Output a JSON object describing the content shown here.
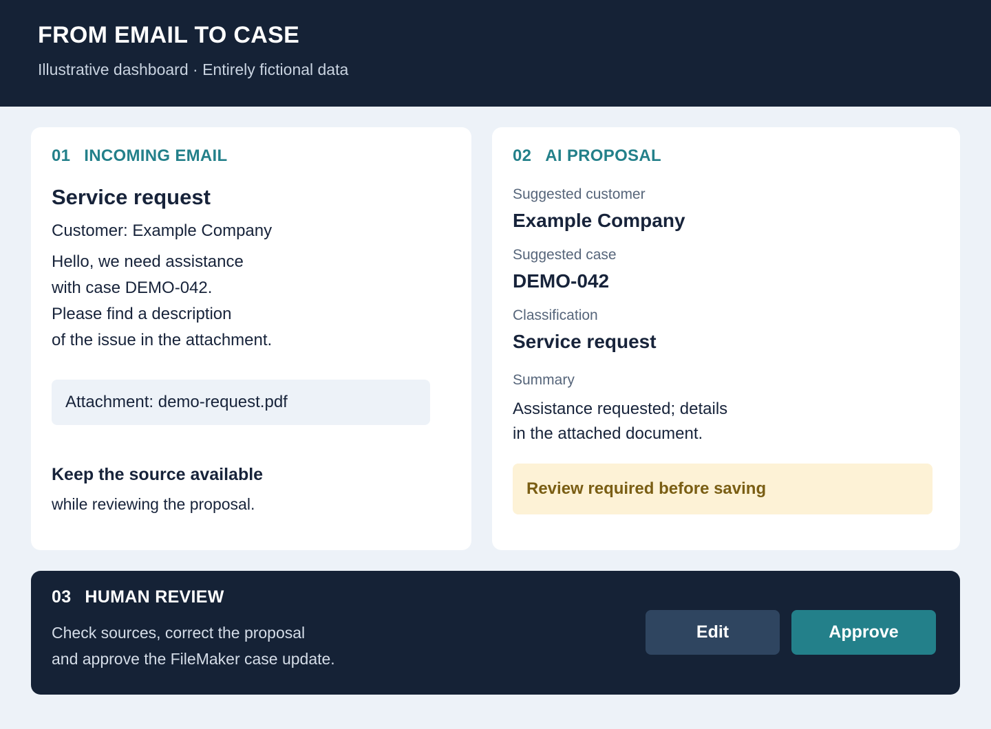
{
  "header": {
    "title": "FROM EMAIL TO CASE",
    "subtitle": "Illustrative dashboard · Entirely fictional data"
  },
  "incoming_email": {
    "number": "01",
    "label": "INCOMING EMAIL",
    "subject": "Service request",
    "customer": "Customer: Example Company",
    "body_lines": [
      "Hello, we need assistance",
      "with case DEMO-042.",
      "Please find a description",
      "of the issue in the attachment."
    ],
    "attachment": "Attachment: demo-request.pdf",
    "keep_title": "Keep the source available",
    "keep_text": "while reviewing the proposal."
  },
  "ai_proposal": {
    "number": "02",
    "label": "AI PROPOSAL",
    "customer_label": "Suggested customer",
    "customer_value": "Example Company",
    "case_label": "Suggested case",
    "case_value": "DEMO-042",
    "classification_label": "Classification",
    "classification_value": "Service request",
    "summary_label": "Summary",
    "summary_lines": [
      "Assistance requested; details",
      "in the attached document."
    ],
    "review_notice": "Review required before saving"
  },
  "human_review": {
    "number": "03",
    "label": "HUMAN REVIEW",
    "text_lines": [
      "Check sources, correct the proposal",
      "and approve the FileMaker case update."
    ],
    "edit_label": "Edit",
    "approve_label": "Approve"
  },
  "colors": {
    "dark_navy": "#152236",
    "teal_accent": "#23808a",
    "page_background": "#edf2f8",
    "warning_background": "#fdf2d6",
    "warning_text": "#7a5e14"
  }
}
